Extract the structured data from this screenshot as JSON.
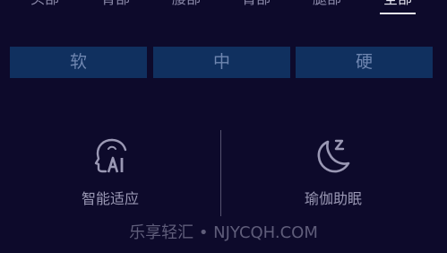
{
  "tabs": [
    {
      "label": "头部",
      "active": false
    },
    {
      "label": "背部",
      "active": false
    },
    {
      "label": "腰部",
      "active": false
    },
    {
      "label": "臀部",
      "active": false
    },
    {
      "label": "腿部",
      "active": false
    },
    {
      "label": "全部",
      "active": true
    }
  ],
  "firmness": {
    "options": [
      "软",
      "中",
      "硬"
    ]
  },
  "modes": [
    {
      "label": "智能适应",
      "icon": "ai-head-icon"
    },
    {
      "label": "瑜伽助眠",
      "icon": "moon-sleep-icon"
    }
  ],
  "watermark": "乐享轻汇 • NJYCQH.COM",
  "colors": {
    "background": "#0d0a2b",
    "button": "#10305f",
    "active_text": "#e6e6f0"
  }
}
